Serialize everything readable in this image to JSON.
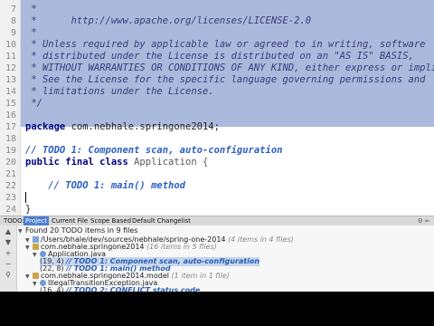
{
  "editor": {
    "lines": [
      {
        "n": "7",
        "segments": [
          {
            "t": " *",
            "c": "doc"
          }
        ],
        "selected": true
      },
      {
        "n": "8",
        "segments": [
          {
            "t": " *      http://www.apache.org/licenses/LICENSE-2.0",
            "c": "doc"
          }
        ],
        "selected": true
      },
      {
        "n": "9",
        "segments": [
          {
            "t": " *",
            "c": "doc"
          }
        ],
        "selected": true
      },
      {
        "n": "10",
        "segments": [
          {
            "t": " * Unless required by applicable law or agreed to in writing, software",
            "c": "doc"
          }
        ],
        "selected": true
      },
      {
        "n": "11",
        "segments": [
          {
            "t": " * distributed under the License is distributed on an \"AS IS\" BASIS,",
            "c": "doc"
          }
        ],
        "selected": true
      },
      {
        "n": "12",
        "segments": [
          {
            "t": " * WITHOUT WARRANTIES OR CONDITIONS OF ANY KIND, either express or implied.",
            "c": "doc"
          }
        ],
        "selected": true
      },
      {
        "n": "13",
        "segments": [
          {
            "t": " * See the License for the specific language governing permissions and",
            "c": "doc"
          }
        ],
        "selected": true
      },
      {
        "n": "14",
        "segments": [
          {
            "t": " * limitations under the License.",
            "c": "doc"
          }
        ],
        "selected": true
      },
      {
        "n": "15",
        "segments": [
          {
            "t": " */",
            "c": "doc"
          }
        ],
        "selected": true
      },
      {
        "n": "16",
        "segments": [
          {
            "t": "",
            "c": ""
          }
        ],
        "selected": false
      },
      {
        "n": "17",
        "segments": [
          {
            "t": "package ",
            "c": "kw"
          },
          {
            "t": "com.nebhale.springone2014;",
            "c": ""
          }
        ],
        "selected": false
      },
      {
        "n": "18",
        "segments": [
          {
            "t": "",
            "c": ""
          }
        ],
        "selected": false
      },
      {
        "n": "19",
        "segments": [
          {
            "t": "// TODO 1: Component scan, auto-configuration",
            "c": "todo"
          }
        ],
        "selected": false
      },
      {
        "n": "20",
        "segments": [
          {
            "t": "public final class ",
            "c": "kw"
          },
          {
            "t": "Application {",
            "c": "cls"
          }
        ],
        "selected": false
      },
      {
        "n": "21",
        "segments": [
          {
            "t": "",
            "c": ""
          }
        ],
        "selected": false
      },
      {
        "n": "22",
        "segments": [
          {
            "t": "    // TODO 1: main() method",
            "c": "todo"
          }
        ],
        "selected": false
      },
      {
        "n": "23",
        "segments": [
          {
            "t": "",
            "c": ""
          }
        ],
        "selected": false,
        "caret": true
      },
      {
        "n": "24",
        "segments": [
          {
            "t": "}",
            "c": ""
          }
        ],
        "selected": false
      }
    ]
  },
  "tabs": {
    "todo_label": "TODO:",
    "items": [
      "Project",
      "Current File",
      "Scope Based",
      "Default Changelist"
    ],
    "active": "Project",
    "right": "⚙ ⇤"
  },
  "todo_panel": {
    "summary": "Found 20 TODO items in 9 files",
    "rows": [
      {
        "indent": 1,
        "icon": "folder",
        "text": "/Users/bhale/dev/sources/nebhale/spring-one-2014",
        "meta": "(4 items in 4 files)",
        "tri": "▼"
      },
      {
        "indent": 1,
        "icon": "pkg",
        "text": "com.nebhale.springone2014",
        "meta": "(16 items in 5 files)",
        "tri": "▼"
      },
      {
        "indent": 2,
        "icon": "file",
        "text": "Application.java",
        "meta": "",
        "tri": "▼"
      },
      {
        "indent": 3,
        "icon": "",
        "pos": "(19, 4)",
        "todo": "// TODO 1: Component scan, auto-configuration",
        "selected": true
      },
      {
        "indent": 3,
        "icon": "",
        "pos": "(22, 8)",
        "todo": "// TODO 1: main() method"
      },
      {
        "indent": 1,
        "icon": "pkg",
        "text": "com.nebhale.springone2014.model",
        "meta": "(1 item in 1 file)",
        "tri": "▼"
      },
      {
        "indent": 2,
        "icon": "file",
        "text": "IllegalTransitionException.java",
        "meta": "",
        "tri": "▼"
      },
      {
        "indent": 3,
        "icon": "",
        "pos": "(16, 4)",
        "todo": "// TODO 2: CONFLICT status code"
      }
    ]
  },
  "side_icons": [
    "up-arrow-icon",
    "down-arrow-icon",
    "expand-icon",
    "collapse-icon",
    "filter-icon"
  ]
}
